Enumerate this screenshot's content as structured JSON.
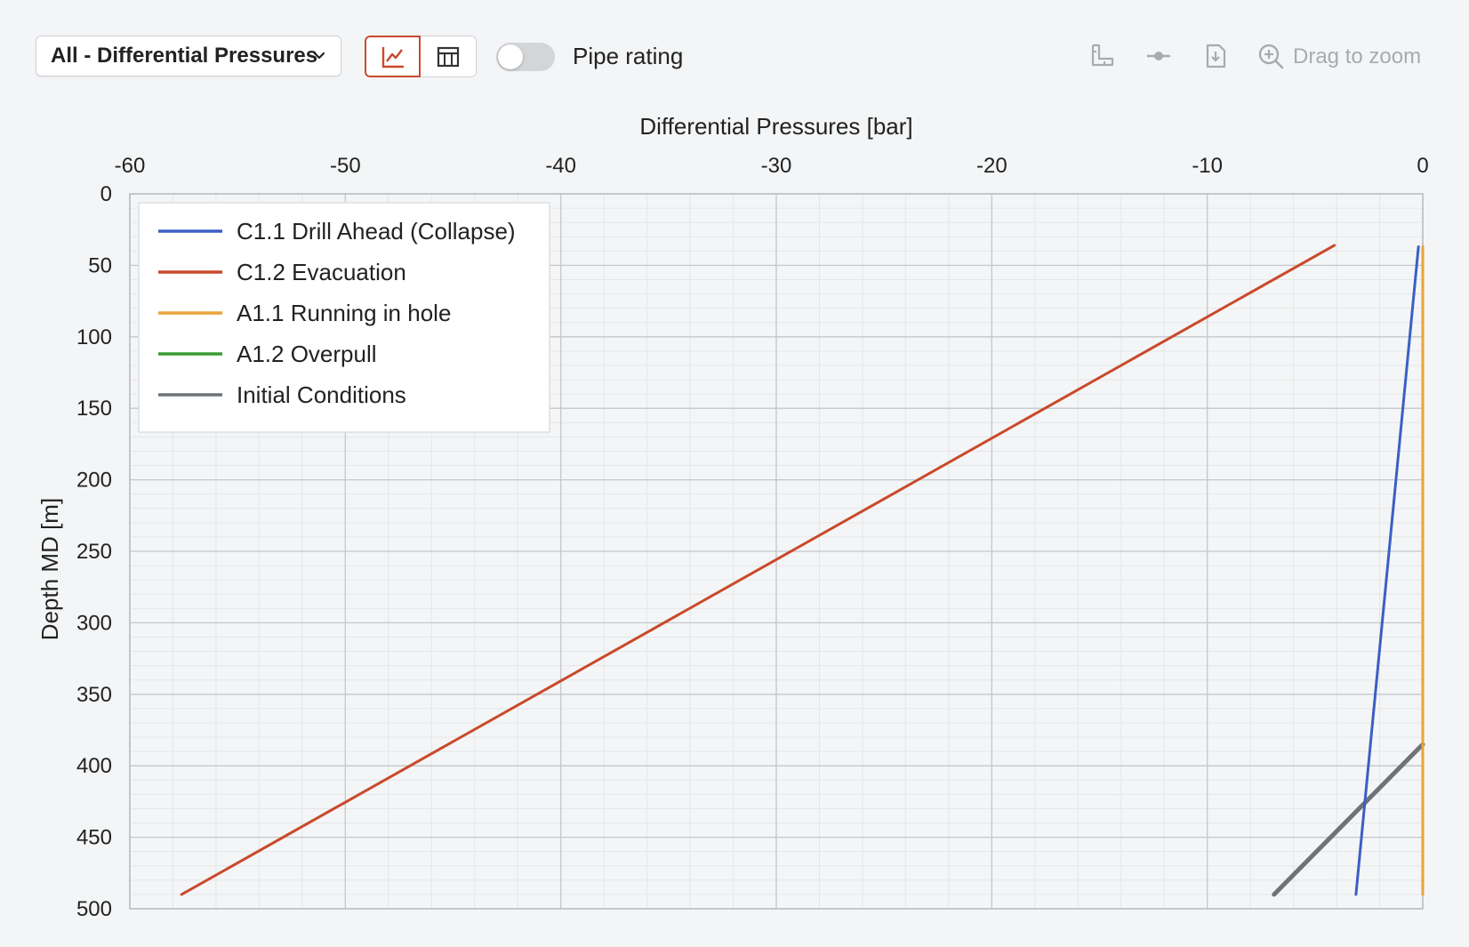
{
  "toolbar": {
    "dropdown_label": "All - Differential Pressures",
    "toggle_label": "Pipe rating",
    "toggle_on": false,
    "zoom_label": "Drag to zoom",
    "icons": [
      "chart-view-icon",
      "table-view-icon",
      "ruler-icon",
      "marker-icon",
      "download-icon",
      "zoom-in-icon"
    ],
    "active_view": "chart"
  },
  "colors": {
    "accent": "#c94a2c",
    "series_blue": "#3b5fc4",
    "series_red": "#c9492b",
    "series_orange": "#e8a33a",
    "series_green": "#3a9a35",
    "series_gray": "#6e7378"
  },
  "chart_data": {
    "type": "line",
    "title": "",
    "xlabel": "Differential Pressures [bar]",
    "ylabel": "Depth MD [m]",
    "xlim": [
      -60,
      0
    ],
    "ylim": [
      0,
      500
    ],
    "x_ticks": [
      "-60",
      "-50",
      "-40",
      "-30",
      "-20",
      "-10",
      "0"
    ],
    "y_ticks": [
      "0",
      "50",
      "100",
      "150",
      "200",
      "250",
      "300",
      "350",
      "400",
      "450",
      "500"
    ],
    "x_axis_position": "top",
    "y_inverted": true,
    "grid": true,
    "legend_position": "top-left",
    "series": [
      {
        "name": "C1.1 Drill Ahead (Collapse)",
        "color": "#3b5fc4",
        "points": [
          [
            -0.2,
            37
          ],
          [
            -3.1,
            490
          ]
        ]
      },
      {
        "name": "C1.2 Evacuation",
        "color": "#c9492b",
        "points": [
          [
            -4.1,
            36
          ],
          [
            -57.6,
            490
          ]
        ]
      },
      {
        "name": "A1.1 Running in hole",
        "color": "#e8a33a",
        "points": [
          [
            0.0,
            37
          ],
          [
            0.0,
            490
          ]
        ]
      },
      {
        "name": "A1.2 Overpull",
        "color": "#3a9a35",
        "points": []
      },
      {
        "name": "Initial Conditions",
        "color": "#6e7378",
        "points": [
          [
            0.0,
            385
          ],
          [
            -6.9,
            490
          ]
        ]
      }
    ]
  }
}
